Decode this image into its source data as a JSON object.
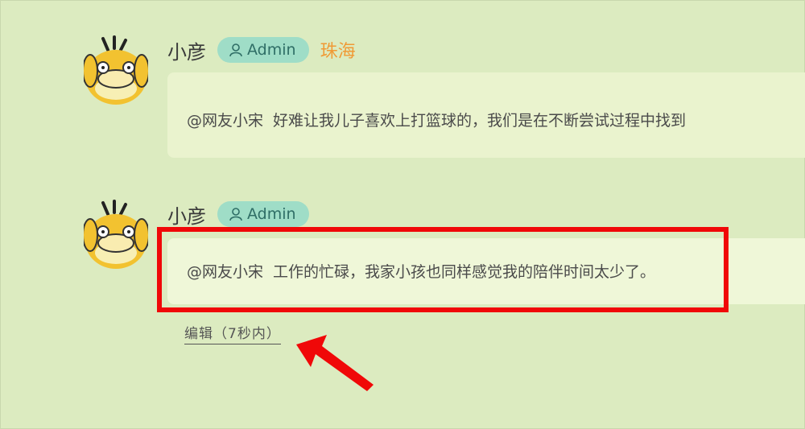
{
  "comments": [
    {
      "username": "小彦",
      "badge": "Admin",
      "location": "珠海",
      "mention": "@网友小宋",
      "text": "好难让我儿子喜欢上打篮球的，我们是在不断尝试过程中找到"
    },
    {
      "username": "小彦",
      "badge": "Admin",
      "mention": "@网友小宋",
      "text": "工作的忙碌，我家小孩也同样感觉我的陪伴时间太少了。",
      "edit_link": "编辑（7秒内）"
    }
  ],
  "icons": {
    "avatar": "psyduck-avatar-icon",
    "badge": "user-icon"
  },
  "colors": {
    "background": "#dcebc0",
    "badge_bg": "#9fddc7",
    "location": "#f09a35",
    "annotation": "#f00808"
  }
}
